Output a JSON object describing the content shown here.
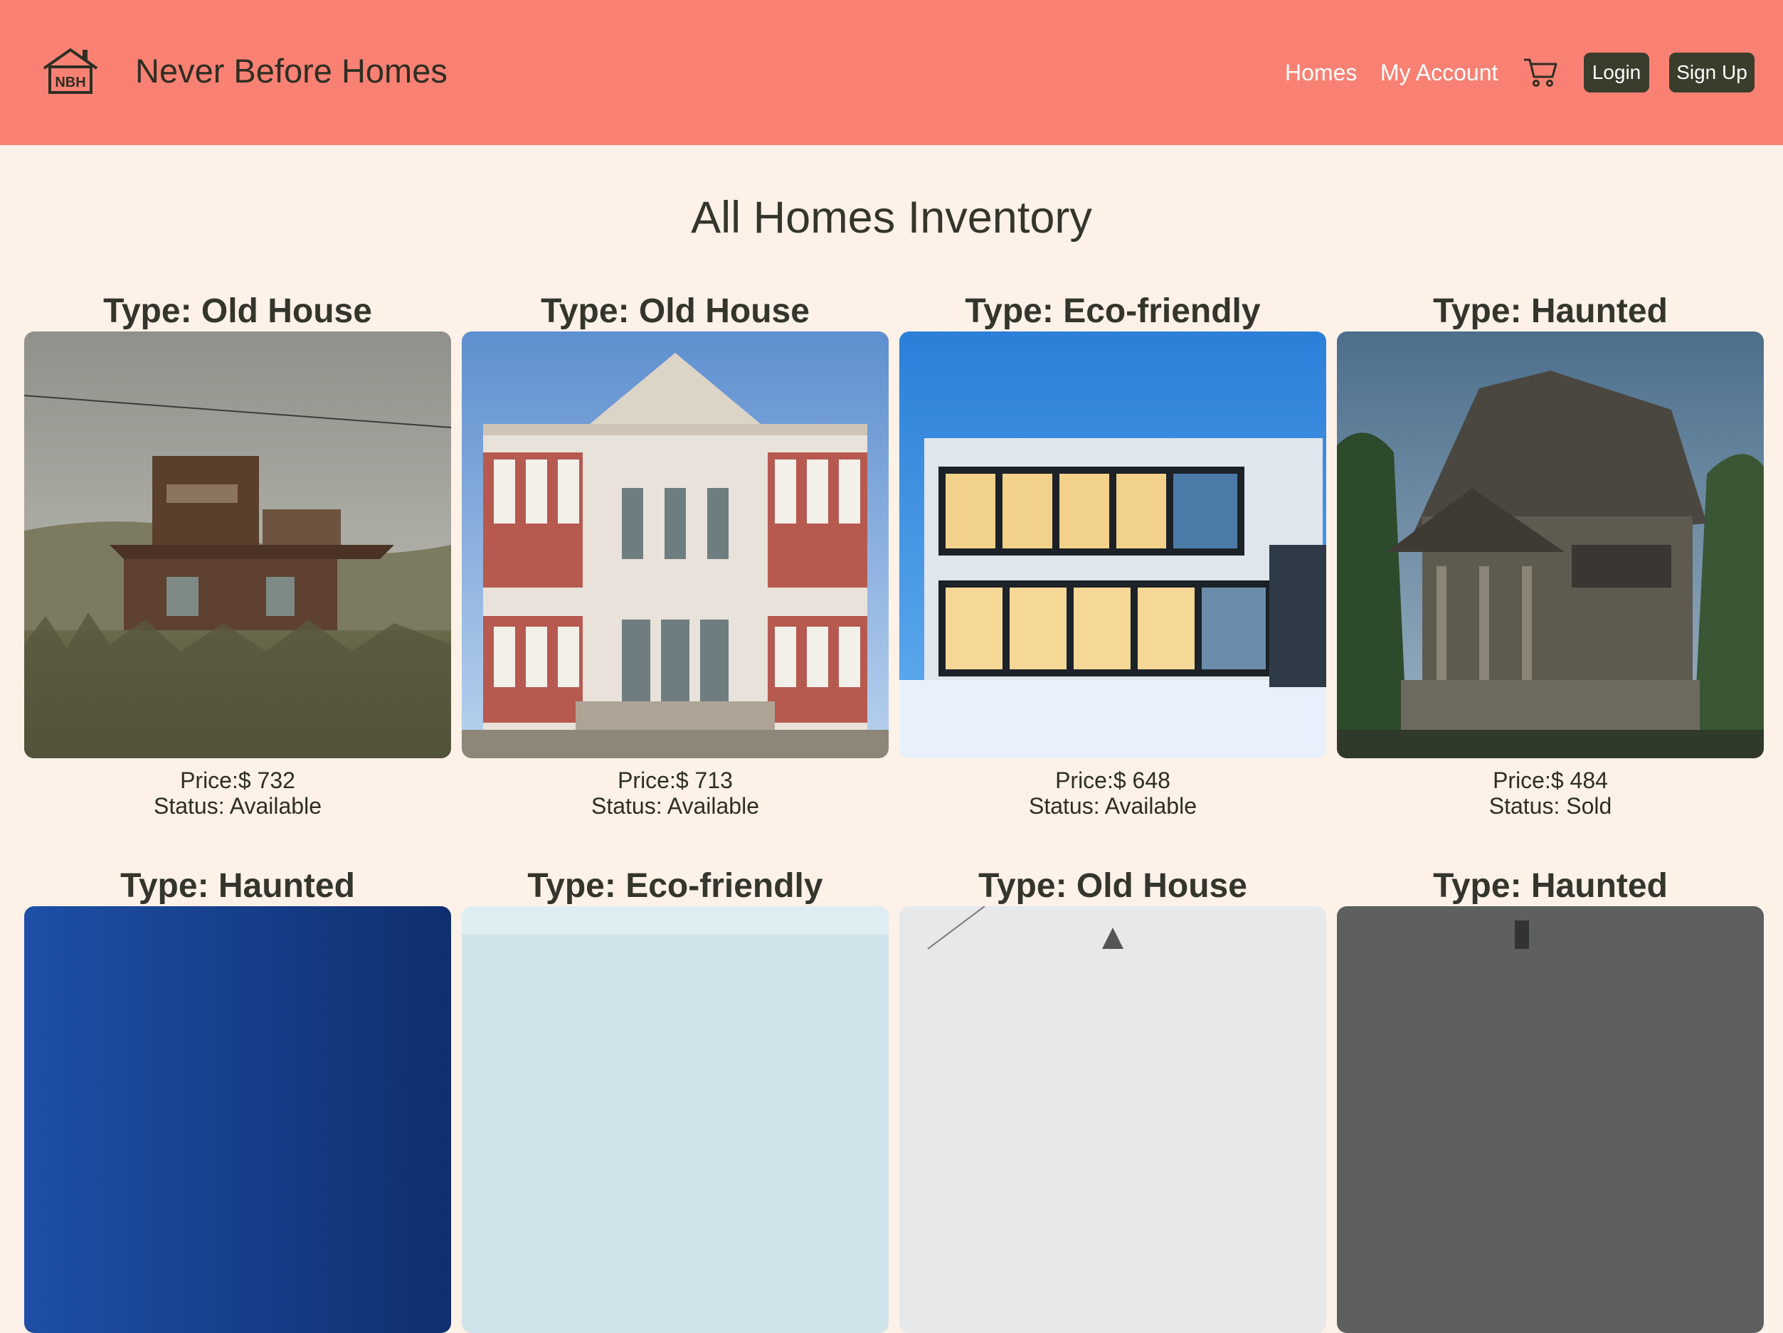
{
  "brand": {
    "logo_text": "NBH",
    "name": "Never Before Homes"
  },
  "nav": {
    "homes": "Homes",
    "my_account": "My Account",
    "cart_icon": "shopping-cart-icon",
    "login": "Login",
    "sign_up": "Sign Up"
  },
  "colors": {
    "header_bg": "#f98174",
    "page_bg": "#fdf1e8",
    "button_bg": "#3a3d2c",
    "text_dark": "#34352b"
  },
  "page_title": "All Homes Inventory",
  "homes": [
    {
      "type": "Type: Old House",
      "price": "Price:$ 732",
      "status": "Status: Available"
    },
    {
      "type": "Type: Old House",
      "price": "Price:$ 713",
      "status": "Status: Available"
    },
    {
      "type": "Type: Eco-friendly",
      "price": "Price:$ 648",
      "status": "Status: Available"
    },
    {
      "type": "Type: Haunted",
      "price": "Price:$ 484",
      "status": "Status: Sold"
    },
    {
      "type": "Type: Haunted"
    },
    {
      "type": "Type: Eco-friendly"
    },
    {
      "type": "Type: Old House"
    },
    {
      "type": "Type: Haunted"
    }
  ]
}
